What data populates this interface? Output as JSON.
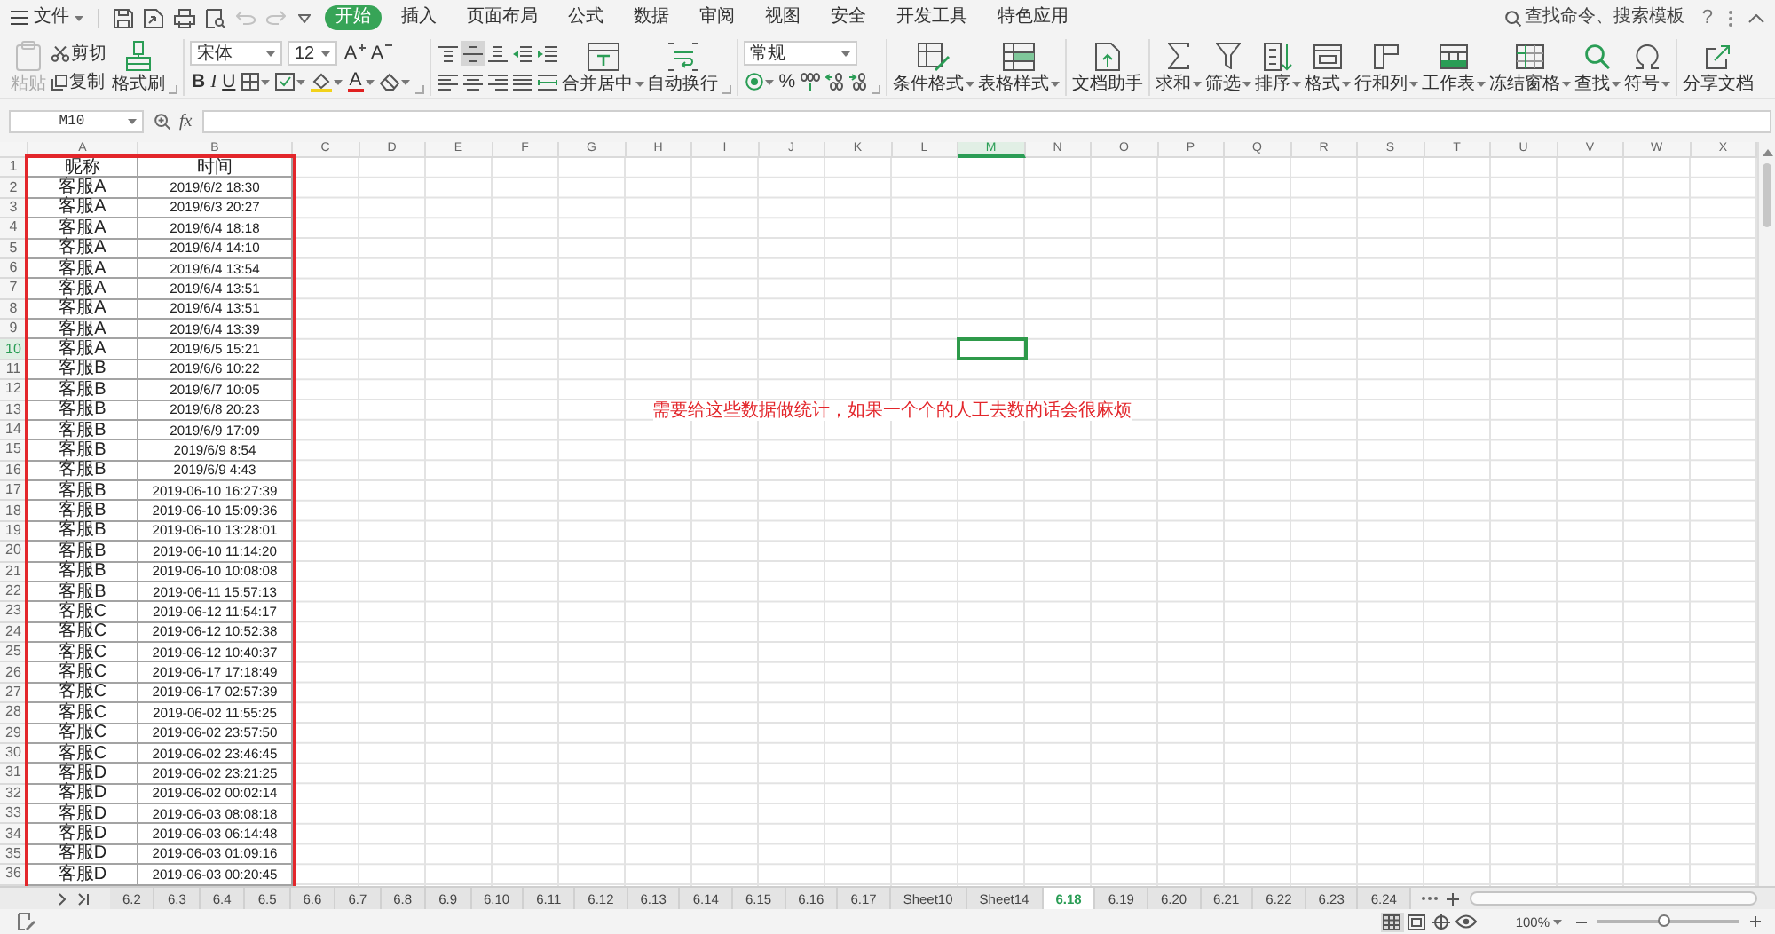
{
  "menu_bar": {
    "file": "文件",
    "quick_access": [
      {
        "disabled": false
      },
      {
        "disabled": false
      },
      {
        "disabled": false
      },
      {
        "disabled": false
      },
      {
        "disabled": true
      },
      {
        "disabled": true
      }
    ],
    "tabs": [
      {
        "label": "开始",
        "selected": true
      },
      {
        "label": "插入",
        "selected": false
      },
      {
        "label": "页面布局",
        "selected": false
      },
      {
        "label": "公式",
        "selected": false
      },
      {
        "label": "数据",
        "selected": false
      },
      {
        "label": "审阅",
        "selected": false
      },
      {
        "label": "视图",
        "selected": false
      },
      {
        "label": "安全",
        "selected": false
      },
      {
        "label": "开发工具",
        "selected": false
      },
      {
        "label": "特色应用",
        "selected": false
      }
    ],
    "search": "查找命令、搜索模板",
    "help": "?"
  },
  "ribbon": {
    "clipboard": {
      "paste": {
        "label": "粘贴",
        "disabled": true
      },
      "cut": "剪切",
      "copy": "复制",
      "painter": "格式刷"
    },
    "font": {
      "name": "宋体",
      "size": "12",
      "grow": "A",
      "shrink": "A",
      "bold": "B",
      "italic": "I",
      "underline": "U",
      "font_color": "A"
    },
    "alignment": {
      "buttons": [
        {
          "selected": false
        },
        {
          "selected": true
        },
        {
          "selected": false
        },
        {
          "selected": false
        },
        {
          "selected": false
        },
        {
          "selected": false
        },
        {
          "selected": false
        },
        {
          "selected": false
        },
        {
          "selected": false
        },
        {
          "selected": false
        }
      ],
      "merge": {
        "label": "合并居中",
        "dropdown": true
      },
      "wrap": {
        "label": "自动换行",
        "dropdown": false
      }
    },
    "number": {
      "format": "常规",
      "percent": "%"
    },
    "command_groups": [
      [
        {
          "label": "条件格式",
          "dropdown": true
        },
        {
          "label": "表格样式",
          "dropdown": true
        }
      ],
      [
        {
          "label": "文档助手",
          "dropdown": false
        }
      ],
      [
        {
          "label": "求和",
          "dropdown": true
        },
        {
          "label": "筛选",
          "dropdown": true
        },
        {
          "label": "排序",
          "dropdown": true
        },
        {
          "label": "格式",
          "dropdown": true
        },
        {
          "label": "行和列",
          "dropdown": true
        },
        {
          "label": "工作表",
          "dropdown": true
        },
        {
          "label": "冻结窗格",
          "dropdown": true
        },
        {
          "label": "查找",
          "dropdown": true
        },
        {
          "label": "符号",
          "dropdown": true
        }
      ],
      [
        {
          "label": "分享文档",
          "dropdown": false
        }
      ]
    ]
  },
  "formula_bar": {
    "name_box": "M10",
    "fx": "fx"
  },
  "sheet": {
    "columns": [
      {
        "label": "A",
        "selected": false
      },
      {
        "label": "B",
        "selected": false
      },
      {
        "label": "C",
        "selected": false
      },
      {
        "label": "D",
        "selected": false
      },
      {
        "label": "E",
        "selected": false
      },
      {
        "label": "F",
        "selected": false
      },
      {
        "label": "G",
        "selected": false
      },
      {
        "label": "H",
        "selected": false
      },
      {
        "label": "I",
        "selected": false
      },
      {
        "label": "J",
        "selected": false
      },
      {
        "label": "K",
        "selected": false
      },
      {
        "label": "L",
        "selected": false
      },
      {
        "label": "M",
        "selected": true
      },
      {
        "label": "N",
        "selected": false
      },
      {
        "label": "O",
        "selected": false
      },
      {
        "label": "P",
        "selected": false
      },
      {
        "label": "Q",
        "selected": false
      },
      {
        "label": "R",
        "selected": false
      },
      {
        "label": "S",
        "selected": false
      },
      {
        "label": "T",
        "selected": false
      },
      {
        "label": "U",
        "selected": false
      },
      {
        "label": "V",
        "selected": false
      },
      {
        "label": "W",
        "selected": false
      },
      {
        "label": "X",
        "selected": false
      }
    ],
    "rows": [
      {
        "number": "1",
        "selected": false,
        "cells": [
          "昵称",
          "时间"
        ]
      },
      {
        "number": "2",
        "selected": false,
        "cells": [
          "客服A",
          "2019/6/2 18:30"
        ]
      },
      {
        "number": "3",
        "selected": false,
        "cells": [
          "客服A",
          "2019/6/3 20:27"
        ]
      },
      {
        "number": "4",
        "selected": false,
        "cells": [
          "客服A",
          "2019/6/4 18:18"
        ]
      },
      {
        "number": "5",
        "selected": false,
        "cells": [
          "客服A",
          "2019/6/4 14:10"
        ]
      },
      {
        "number": "6",
        "selected": false,
        "cells": [
          "客服A",
          "2019/6/4 13:54"
        ]
      },
      {
        "number": "7",
        "selected": false,
        "cells": [
          "客服A",
          "2019/6/4 13:51"
        ]
      },
      {
        "number": "8",
        "selected": false,
        "cells": [
          "客服A",
          "2019/6/4 13:51"
        ]
      },
      {
        "number": "9",
        "selected": false,
        "cells": [
          "客服A",
          "2019/6/4 13:39"
        ]
      },
      {
        "number": "10",
        "selected": true,
        "cells": [
          "客服A",
          "2019/6/5 15:21"
        ]
      },
      {
        "number": "11",
        "selected": false,
        "cells": [
          "客服B",
          "2019/6/6 10:22"
        ]
      },
      {
        "number": "12",
        "selected": false,
        "cells": [
          "客服B",
          "2019/6/7 10:05"
        ]
      },
      {
        "number": "13",
        "selected": false,
        "cells": [
          "客服B",
          "2019/6/8 20:23"
        ]
      },
      {
        "number": "14",
        "selected": false,
        "cells": [
          "客服B",
          "2019/6/9 17:09"
        ]
      },
      {
        "number": "15",
        "selected": false,
        "cells": [
          "客服B",
          "2019/6/9 8:54"
        ]
      },
      {
        "number": "16",
        "selected": false,
        "cells": [
          "客服B",
          "2019/6/9 4:43"
        ]
      },
      {
        "number": "17",
        "selected": false,
        "cells": [
          "客服B",
          "2019-06-10 16:27:39"
        ]
      },
      {
        "number": "18",
        "selected": false,
        "cells": [
          "客服B",
          "2019-06-10 15:09:36"
        ]
      },
      {
        "number": "19",
        "selected": false,
        "cells": [
          "客服B",
          "2019-06-10 13:28:01"
        ]
      },
      {
        "number": "20",
        "selected": false,
        "cells": [
          "客服B",
          "2019-06-10 11:14:20"
        ]
      },
      {
        "number": "21",
        "selected": false,
        "cells": [
          "客服B",
          "2019-06-10 10:08:08"
        ]
      },
      {
        "number": "22",
        "selected": false,
        "cells": [
          "客服B",
          "2019-06-11 15:57:13"
        ]
      },
      {
        "number": "23",
        "selected": false,
        "cells": [
          "客服C",
          "2019-06-12 11:54:17"
        ]
      },
      {
        "number": "24",
        "selected": false,
        "cells": [
          "客服C",
          "2019-06-12 10:52:38"
        ]
      },
      {
        "number": "25",
        "selected": false,
        "cells": [
          "客服C",
          "2019-06-12 10:40:37"
        ]
      },
      {
        "number": "26",
        "selected": false,
        "cells": [
          "客服C",
          "2019-06-17 17:18:49"
        ]
      },
      {
        "number": "27",
        "selected": false,
        "cells": [
          "客服C",
          "2019-06-17 02:57:39"
        ]
      },
      {
        "number": "28",
        "selected": false,
        "cells": [
          "客服C",
          "2019-06-02 11:55:25"
        ]
      },
      {
        "number": "29",
        "selected": false,
        "cells": [
          "客服C",
          "2019-06-02 23:57:50"
        ]
      },
      {
        "number": "30",
        "selected": false,
        "cells": [
          "客服C",
          "2019-06-02 23:46:45"
        ]
      },
      {
        "number": "31",
        "selected": false,
        "cells": [
          "客服D",
          "2019-06-02 23:21:25"
        ]
      },
      {
        "number": "32",
        "selected": false,
        "cells": [
          "客服D",
          "2019-06-02 00:02:14"
        ]
      },
      {
        "number": "33",
        "selected": false,
        "cells": [
          "客服D",
          "2019-06-03 08:08:18"
        ]
      },
      {
        "number": "34",
        "selected": false,
        "cells": [
          "客服D",
          "2019-06-03 06:14:48"
        ]
      },
      {
        "number": "35",
        "selected": false,
        "cells": [
          "客服D",
          "2019-06-03 01:09:16"
        ]
      },
      {
        "number": "36",
        "selected": false,
        "cells": [
          "客服D",
          "2019-06-03 00:20:45"
        ]
      }
    ],
    "frame": true,
    "note": "需要给这些数据做统计，如果一个个的人工去数的话会很麻烦"
  },
  "sheet_tabs": [
    {
      "label": "6.2",
      "selected": false
    },
    {
      "label": "6.3",
      "selected": false
    },
    {
      "label": "6.4",
      "selected": false
    },
    {
      "label": "6.5",
      "selected": false
    },
    {
      "label": "6.6",
      "selected": false
    },
    {
      "label": "6.7",
      "selected": false
    },
    {
      "label": "6.8",
      "selected": false
    },
    {
      "label": "6.9",
      "selected": false
    },
    {
      "label": "6.10",
      "selected": false
    },
    {
      "label": "6.11",
      "selected": false
    },
    {
      "label": "6.12",
      "selected": false
    },
    {
      "label": "6.13",
      "selected": false
    },
    {
      "label": "6.14",
      "selected": false
    },
    {
      "label": "6.15",
      "selected": false
    },
    {
      "label": "6.16",
      "selected": false
    },
    {
      "label": "6.17",
      "selected": false
    },
    {
      "label": "Sheet10",
      "selected": false
    },
    {
      "label": "Sheet14",
      "selected": false
    },
    {
      "label": "6.18",
      "selected": true
    },
    {
      "label": "6.19",
      "selected": false
    },
    {
      "label": "6.20",
      "selected": false
    },
    {
      "label": "6.21",
      "selected": false
    },
    {
      "label": "6.22",
      "selected": false
    },
    {
      "label": "6.23",
      "selected": false
    },
    {
      "label": "6.24",
      "selected": false
    }
  ],
  "status_bar": {
    "views": [
      {
        "selected": true
      },
      {
        "selected": false
      },
      {
        "selected": false
      },
      {
        "selected": false
      }
    ],
    "zoom": "100%",
    "zoom_slider": {
      "level": 0.47
    }
  }
}
